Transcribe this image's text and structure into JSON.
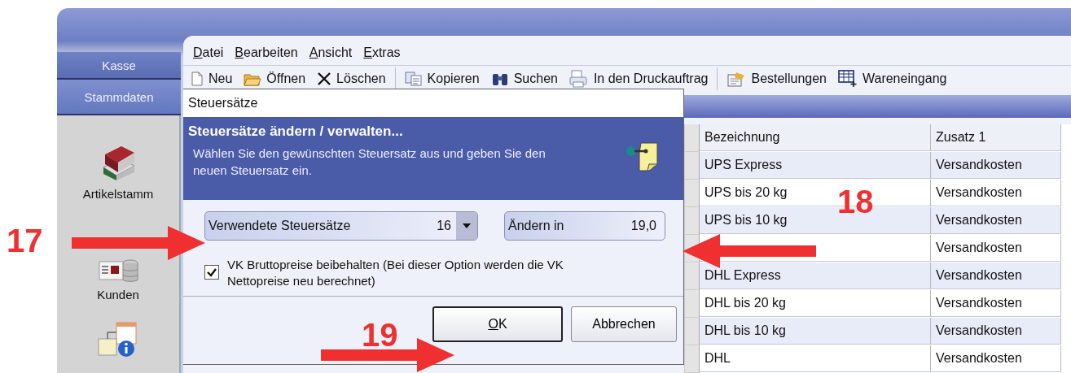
{
  "nav": {
    "tabs": [
      {
        "label": "Kasse",
        "selected": false
      },
      {
        "label": "Stammdaten",
        "selected": true
      }
    ],
    "items": [
      {
        "label": "Artikelstamm"
      },
      {
        "label": "Kunden"
      }
    ]
  },
  "menu": [
    "Datei",
    "Bearbeiten",
    "Ansicht",
    "Extras"
  ],
  "toolbar": [
    {
      "kind": "button",
      "label": "Neu"
    },
    {
      "kind": "button",
      "label": "Öffnen"
    },
    {
      "kind": "button",
      "label": "Löschen"
    },
    {
      "kind": "separator"
    },
    {
      "kind": "button",
      "label": "Kopieren"
    },
    {
      "kind": "button",
      "label": "Suchen"
    },
    {
      "kind": "button",
      "label": "In den Druckauftrag"
    },
    {
      "kind": "separator"
    },
    {
      "kind": "button",
      "label": "Bestellungen"
    },
    {
      "kind": "button",
      "label": "Wareneingang"
    }
  ],
  "table": {
    "columns": [
      "Bezeichnung",
      "Zusatz 1"
    ],
    "rows": [
      {
        "name": "UPS Express",
        "extra": "Versandkosten"
      },
      {
        "name": "UPS bis 20 kg",
        "extra": "Versandkosten"
      },
      {
        "name": "UPS bis 10 kg",
        "extra": "Versandkosten"
      },
      {
        "extra": "Versandkosten"
      },
      {
        "name": "DHL Express",
        "extra": "Versandkosten"
      },
      {
        "name": "DHL bis 20 kg",
        "extra": "Versandkosten"
      },
      {
        "name": "DHL bis 10 kg",
        "extra": "Versandkosten"
      },
      {
        "name": "DHL",
        "extra": "Versandkosten"
      }
    ]
  },
  "dialog": {
    "title": "Steuersätze",
    "heading": "Steuersätze ändern / verwalten...",
    "description": "Wählen Sie den gewünschten Steuersatz aus und geben Sie den neuen Steuersatz ein.",
    "combo": {
      "label": "Verwendete Steuersätze",
      "value": "16"
    },
    "field": {
      "label": "Ändern in",
      "value": "19,0"
    },
    "checkbox": {
      "label": "VK Bruttopreise beibehalten (Bei dieser Option werden die VK Nettopreise neu berechnet)",
      "checked": true
    },
    "buttons": [
      {
        "label": "OK"
      },
      {
        "label": "Abbrechen"
      }
    ]
  },
  "annotations": [
    {
      "number": "17"
    },
    {
      "number": "18"
    },
    {
      "number": "19"
    }
  ]
}
